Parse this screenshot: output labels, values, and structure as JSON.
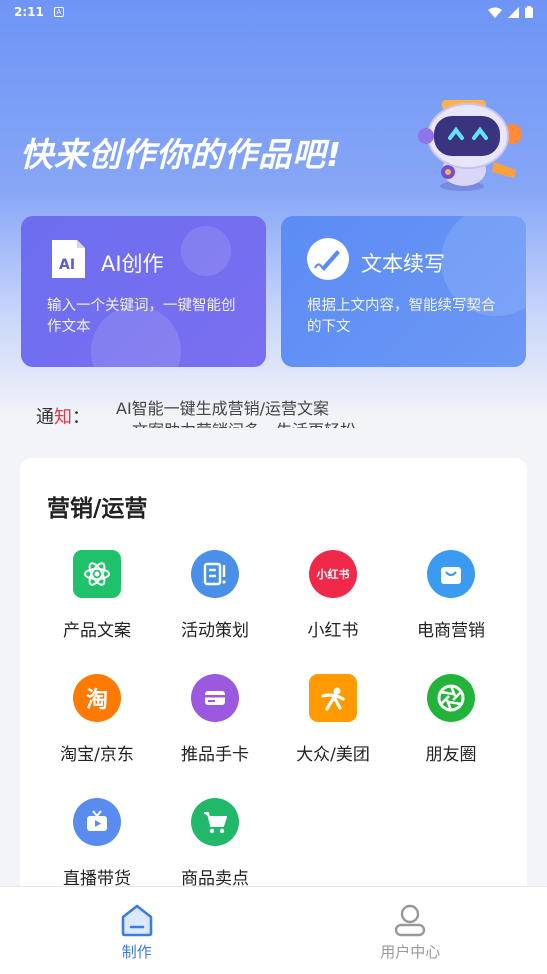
{
  "status_bar": {
    "time": "2:11",
    "notification_icon": "A"
  },
  "hero": {
    "title": "快来创作你的作品吧!"
  },
  "cards": [
    {
      "title": "AI创作",
      "icon_text": "AI",
      "desc": "输入一个关键词，一键智能创作文本",
      "color": "#6d6df0"
    },
    {
      "title": "文本续写",
      "desc": "根据上文内容，智能续写契合的下文",
      "color": "#5b8cf5"
    }
  ],
  "notice": {
    "label_part1": "通",
    "label_part2": "知",
    "label_colon": "：",
    "lines": [
      "AI智能一键生成营销/运营文案",
      "一文案助力营销问多，生活更轻松"
    ]
  },
  "section": {
    "title": "营销/运营",
    "items": [
      {
        "label": "产品文案",
        "icon": "atom-icon",
        "color": "#1fc16b",
        "glyph": ""
      },
      {
        "label": "活动策划",
        "icon": "document-icon",
        "color": "#4a90e8",
        "glyph": ""
      },
      {
        "label": "小红书",
        "icon": "xiaohongshu-icon",
        "color": "#f0294a",
        "glyph": "小红书"
      },
      {
        "label": "电商营销",
        "icon": "shopping-bag-icon",
        "color": "#3a9bf0",
        "glyph": ""
      },
      {
        "label": "淘宝/京东",
        "icon": "taobao-icon",
        "color": "#ff7a00",
        "glyph": "淘"
      },
      {
        "label": "推品手卡",
        "icon": "card-icon",
        "color": "#9b59e0",
        "glyph": ""
      },
      {
        "label": "大众/美团",
        "icon": "dianping-icon",
        "color": "#ff9a00",
        "glyph": ""
      },
      {
        "label": "朋友圈",
        "icon": "moments-icon",
        "color": "#22b43a",
        "glyph": ""
      },
      {
        "label": "直播带货",
        "icon": "tv-icon",
        "color": "#5a8cf0",
        "glyph": ""
      },
      {
        "label": "商品卖点",
        "icon": "cart-icon",
        "color": "#22b86a",
        "glyph": ""
      }
    ]
  },
  "tabbar": [
    {
      "label": "制作",
      "icon": "home-icon",
      "active": true
    },
    {
      "label": "用户中心",
      "icon": "user-icon",
      "active": false
    }
  ]
}
